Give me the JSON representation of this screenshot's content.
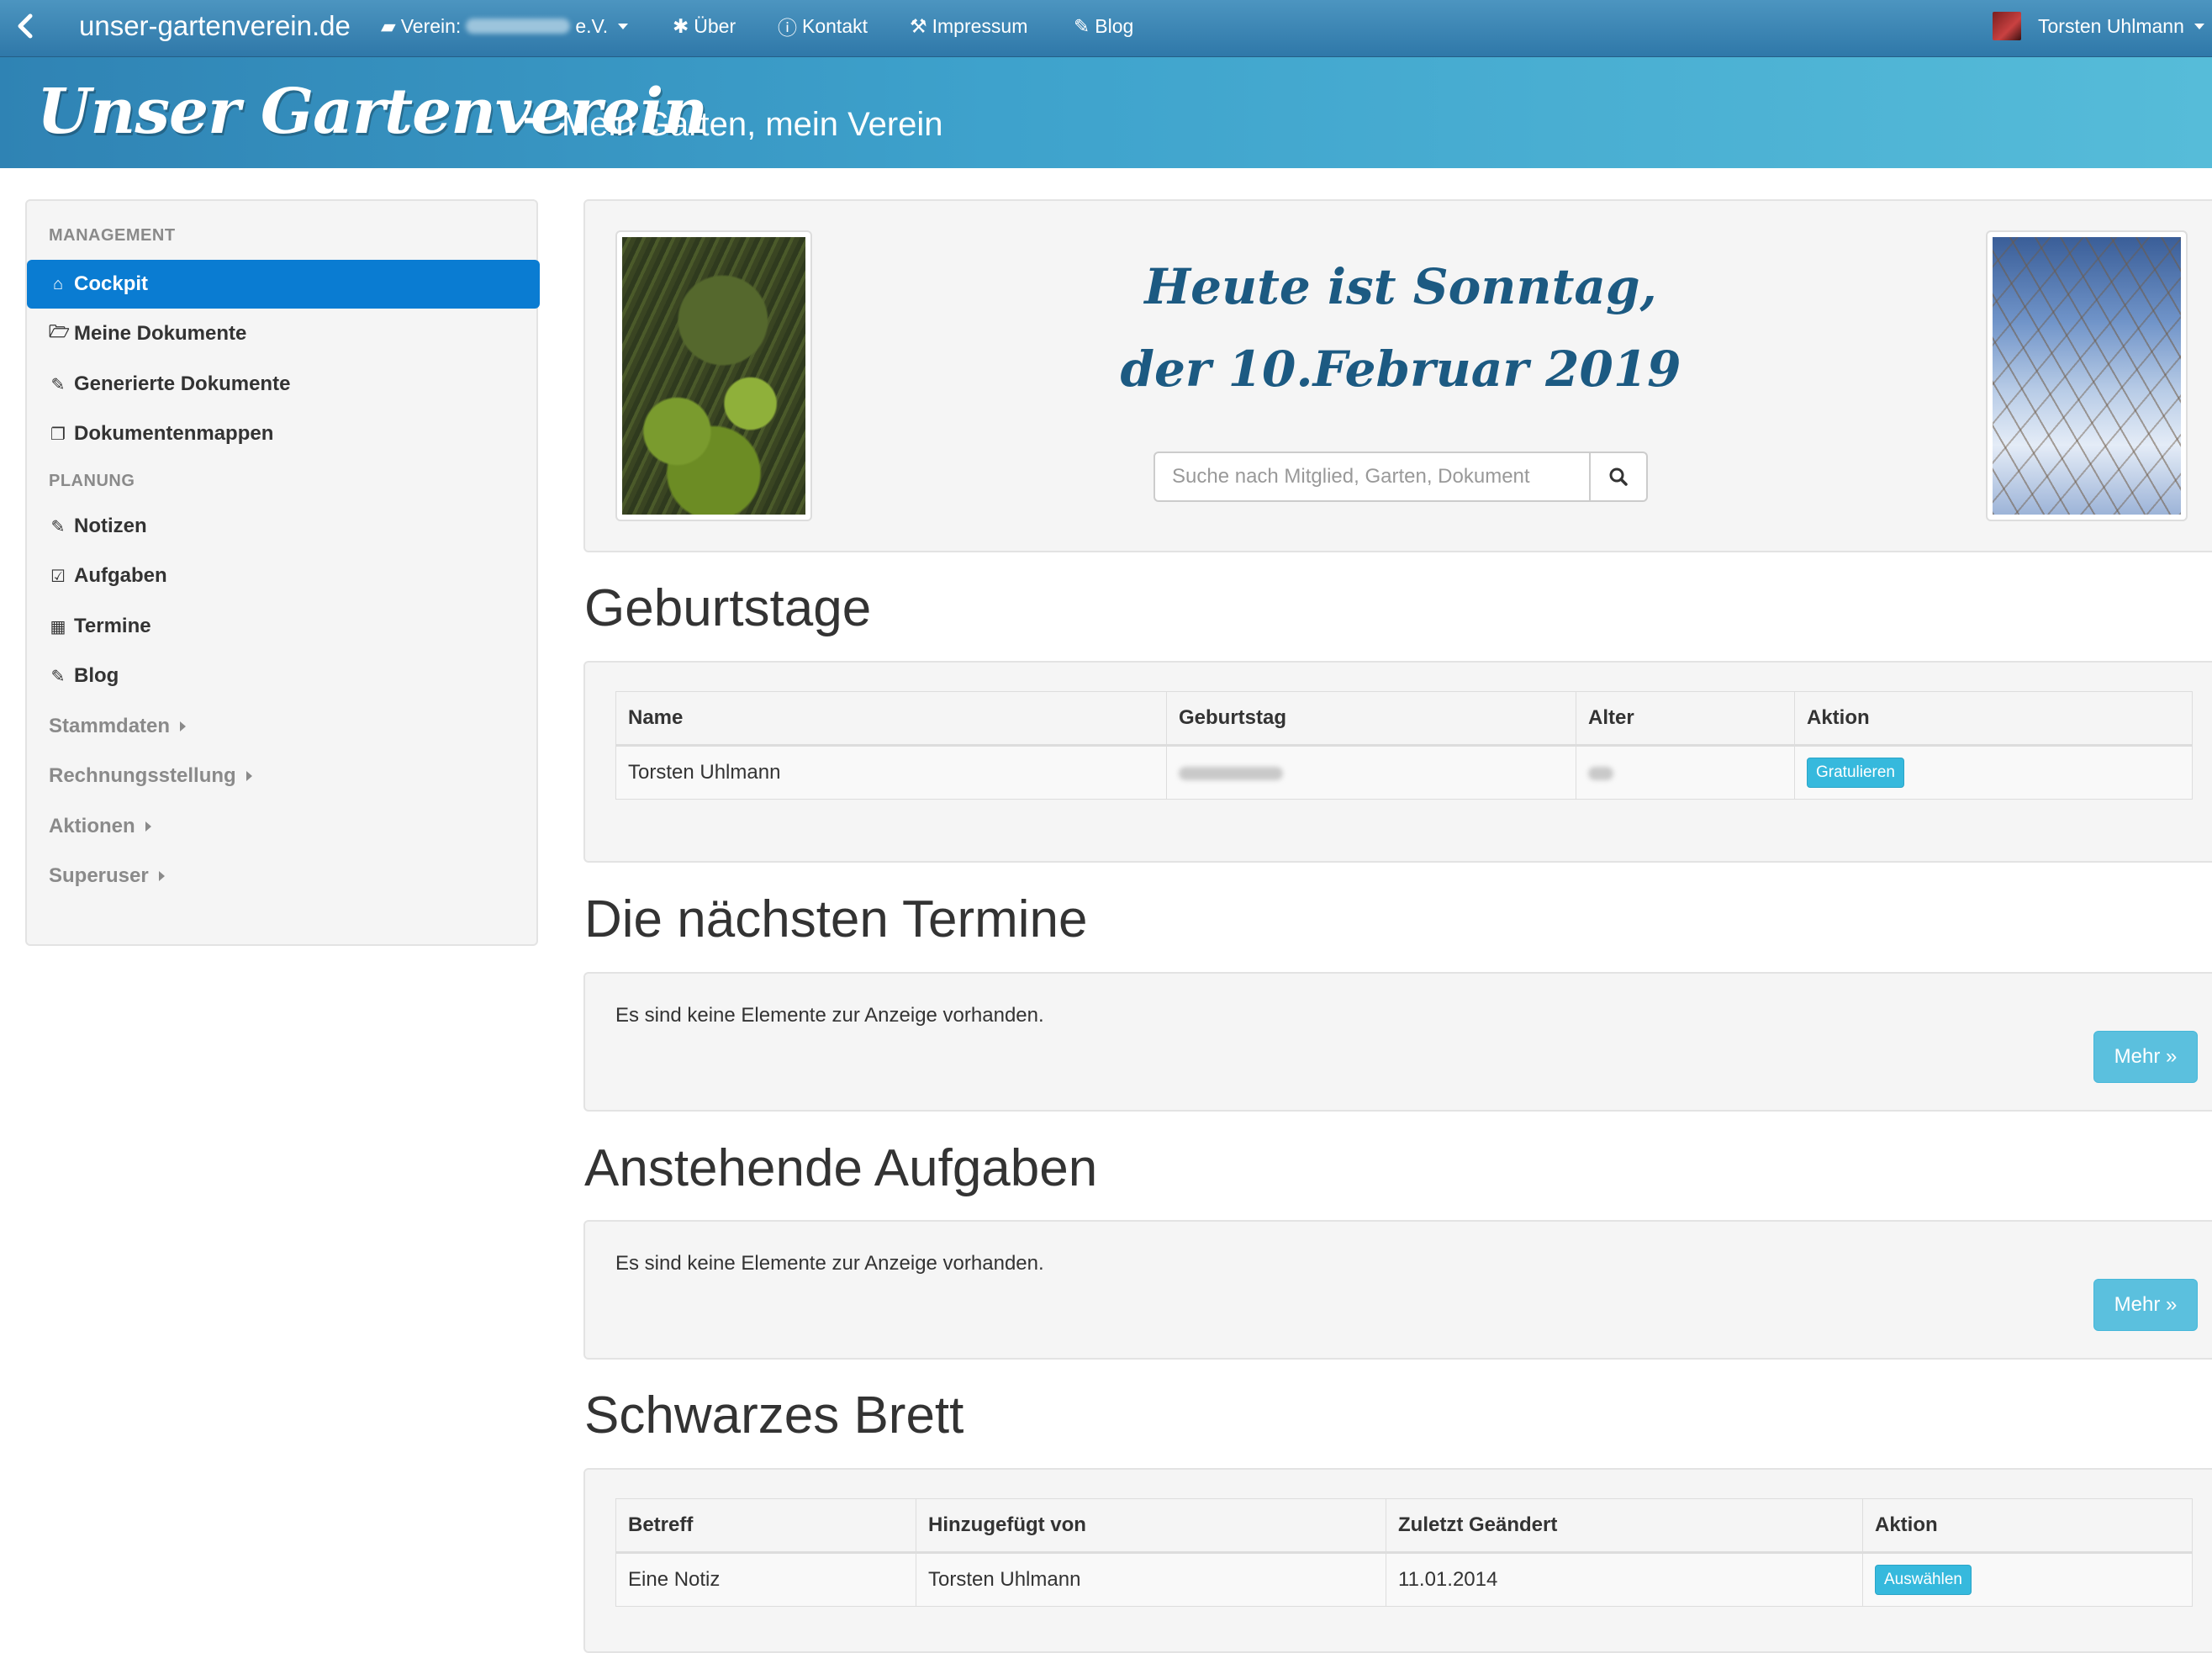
{
  "topnav": {
    "brand": "unser-gartenverein.de",
    "verein_label": "Verein:",
    "verein_suffix": "e.V.",
    "ueber": "Über",
    "kontakt": "Kontakt",
    "impressum": "Impressum",
    "blog": "Blog",
    "user_name": "Torsten Uhlmann"
  },
  "banner": {
    "title": "Unser Gartenverein",
    "dash": "-",
    "subtitle": "Mein Garten, mein Verein"
  },
  "sidebar": {
    "management_header": "MANAGEMENT",
    "planung_header": "PLANUNG",
    "items": {
      "cockpit": "Cockpit",
      "meine_dokumente": "Meine Dokumente",
      "generierte_dokumente": "Generierte Dokumente",
      "dokumentenmappen": "Dokumentenmappen",
      "notizen": "Notizen",
      "aufgaben": "Aufgaben",
      "termine": "Termine",
      "blog": "Blog",
      "stammdaten": "Stammdaten",
      "rechnungsstellung": "Rechnungsstellung",
      "aktionen": "Aktionen",
      "superuser": "Superuser"
    }
  },
  "hero": {
    "greeting_line1": "Heute ist Sonntag,",
    "greeting_line2": "der 10.Februar 2019",
    "search_placeholder": "Suche nach Mitglied, Garten, Dokument"
  },
  "birthdays": {
    "title": "Geburtstage",
    "columns": [
      "Name",
      "Geburtstag",
      "Alter",
      "Aktion"
    ],
    "rows": [
      {
        "name": "Torsten Uhlmann",
        "action": "Gratulieren"
      }
    ]
  },
  "events": {
    "title": "Die nächsten Termine",
    "empty": "Es sind keine Elemente zur Anzeige vorhanden.",
    "more": "Mehr »"
  },
  "tasks": {
    "title": "Anstehende Aufgaben",
    "empty": "Es sind keine Elemente zur Anzeige vorhanden.",
    "more": "Mehr »"
  },
  "board": {
    "title": "Schwarzes Brett",
    "columns": [
      "Betreff",
      "Hinzugefügt von",
      "Zuletzt Geändert",
      "Aktion"
    ],
    "rows": [
      {
        "subject": "Eine Notiz",
        "added_by": "Torsten Uhlmann",
        "changed": "11.01.2014",
        "action": "Auswählen"
      }
    ]
  },
  "colors": {
    "navbar": "#3580b0",
    "active": "#0a7cd2",
    "info": "#5bc0de"
  }
}
